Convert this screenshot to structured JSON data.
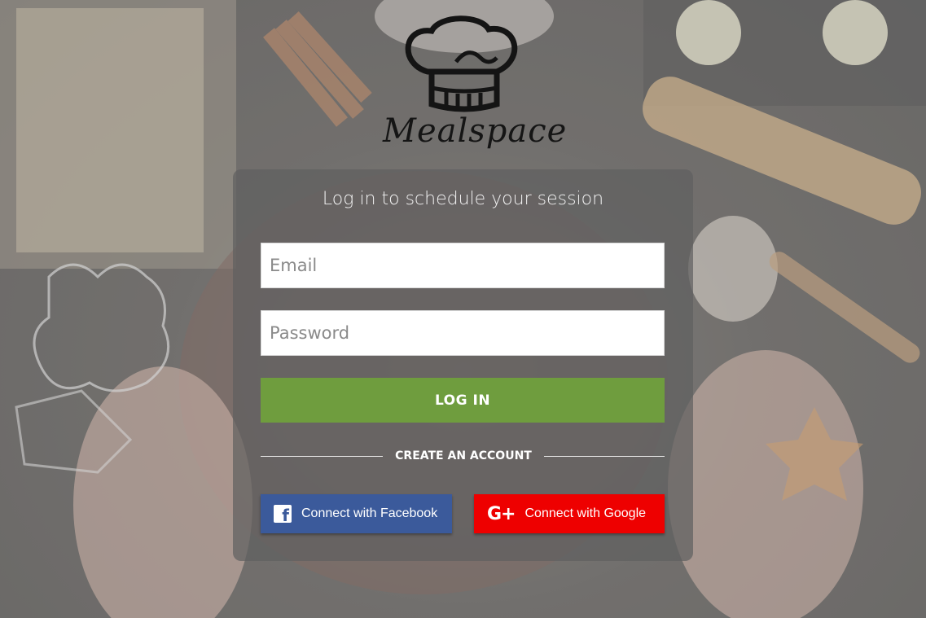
{
  "brand": {
    "name": "Mealspace"
  },
  "card": {
    "subtitle": "Log in to schedule your session",
    "email": {
      "placeholder": "Email",
      "value": ""
    },
    "password": {
      "placeholder": "Password",
      "value": ""
    },
    "login_label": "LOG IN",
    "create_account_label": "CREATE AN ACCOUNT",
    "facebook_label": "Connect with Facebook",
    "google_label": "Connect with Google"
  },
  "colors": {
    "login_green": "#6f9d3e",
    "facebook_blue": "#3b5a9b",
    "google_red": "#ee0000",
    "card_bg": "#5f5f5f"
  },
  "icons": [
    "chef-hat-logo-icon",
    "facebook-icon",
    "google-plus-icon"
  ]
}
